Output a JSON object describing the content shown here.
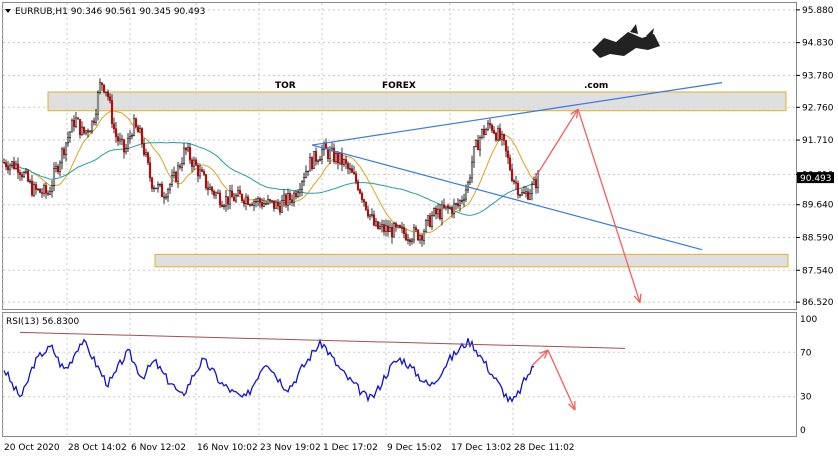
{
  "chart_data": [
    {
      "type": "candlestick",
      "header": "EURRUB,H1  90.346 90.561 90.345 90.493",
      "current_price_label": "90.493",
      "current_price": 90.493,
      "ylim": [
        86.3,
        96.1
      ],
      "y_ticks": [
        "95.880",
        "94.830",
        "93.780",
        "92.760",
        "91.710",
        "90.610",
        "89.640",
        "88.590",
        "87.540",
        "86.520"
      ],
      "y_tick_values": [
        95.88,
        94.83,
        93.78,
        92.76,
        91.71,
        90.61,
        89.64,
        88.59,
        87.54,
        86.52
      ],
      "x_ticks": [
        "20 Oct 2020",
        "28 Oct 14:02",
        "6 Nov 12:02",
        "16 Nov 10:02",
        "23 Nov 19:02",
        "1 Dec 17:02",
        "9 Dec 15:02",
        "17 Dec 13:02",
        "28 Dec 11:02"
      ],
      "close_path": [
        [
          0,
          91.0
        ],
        [
          15,
          90.9
        ],
        [
          30,
          90.1
        ],
        [
          45,
          90.0
        ],
        [
          60,
          91.4
        ],
        [
          72,
          92.4
        ],
        [
          80,
          91.9
        ],
        [
          90,
          92.3
        ],
        [
          98,
          93.6
        ],
        [
          104,
          93.3
        ],
        [
          112,
          91.9
        ],
        [
          122,
          91.3
        ],
        [
          130,
          92.2
        ],
        [
          138,
          91.8
        ],
        [
          148,
          90.4
        ],
        [
          160,
          90.0
        ],
        [
          172,
          90.5
        ],
        [
          182,
          91.4
        ],
        [
          192,
          90.9
        ],
        [
          205,
          90.2
        ],
        [
          220,
          89.8
        ],
        [
          240,
          89.9
        ],
        [
          260,
          89.7
        ],
        [
          275,
          89.6
        ],
        [
          290,
          89.9
        ],
        [
          305,
          90.9
        ],
        [
          320,
          91.4
        ],
        [
          340,
          91.0
        ],
        [
          355,
          90.3
        ],
        [
          372,
          88.9
        ],
        [
          390,
          88.8
        ],
        [
          405,
          88.7
        ],
        [
          418,
          88.7
        ],
        [
          430,
          89.3
        ],
        [
          445,
          89.5
        ],
        [
          455,
          89.6
        ],
        [
          465,
          90.3
        ],
        [
          470,
          91.2
        ],
        [
          478,
          91.9
        ],
        [
          488,
          92.2
        ],
        [
          500,
          91.6
        ],
        [
          510,
          90.5
        ],
        [
          520,
          89.9
        ],
        [
          530,
          90.2
        ],
        [
          535,
          90.5
        ]
      ],
      "support_zones": [
        [
          92.65,
          93.25
        ],
        [
          87.65,
          88.05
        ]
      ],
      "trendlines": [
        [
          [
            312,
            91.55
          ],
          [
            722,
            93.55
          ]
        ],
        [
          [
            312,
            91.55
          ],
          [
            702,
            88.2
          ]
        ]
      ],
      "forecast_arrow": [
        [
          535,
          90.5
        ],
        [
          578,
          92.7
        ],
        [
          640,
          86.5
        ]
      ]
    },
    {
      "type": "line",
      "header": "RSI(13) 56.8300",
      "ylim": [
        0,
        100
      ],
      "y_ticks": [
        "100",
        "70",
        "30",
        "0"
      ],
      "y_tick_values": [
        100,
        70,
        30,
        0
      ],
      "levels": [
        30,
        70
      ],
      "values": [
        55,
        48,
        40,
        34,
        30,
        38,
        50,
        60,
        65,
        70,
        72,
        75,
        68,
        60,
        55,
        58,
        66,
        74,
        80,
        76,
        70,
        62,
        55,
        48,
        42,
        45,
        52,
        60,
        66,
        70,
        62,
        55,
        48,
        52,
        58,
        62,
        56,
        50,
        45,
        42,
        36,
        30,
        35,
        42,
        50,
        56,
        62,
        60,
        55,
        50,
        44,
        40,
        38,
        34,
        32,
        30,
        28,
        35,
        42,
        50,
        58,
        62,
        56,
        50,
        45,
        40,
        38,
        42,
        48,
        55,
        60,
        66,
        72,
        76,
        78,
        72,
        66,
        60,
        55,
        50,
        46,
        42,
        38,
        34,
        30,
        28,
        32,
        38,
        46,
        52,
        58,
        62,
        64,
        62,
        58,
        54,
        50,
        46,
        42,
        40,
        44,
        50,
        56,
        62,
        66,
        70,
        74,
        78,
        80,
        76,
        70,
        64,
        58,
        52,
        46,
        40,
        34,
        28,
        25,
        30,
        38,
        46,
        52,
        57
      ],
      "trendline": [
        [
          20,
          88
        ],
        [
          625,
          73.5
        ]
      ],
      "forecast_arrow": [
        [
          532,
          58
        ],
        [
          548,
          72
        ],
        [
          575,
          18
        ]
      ]
    }
  ]
}
